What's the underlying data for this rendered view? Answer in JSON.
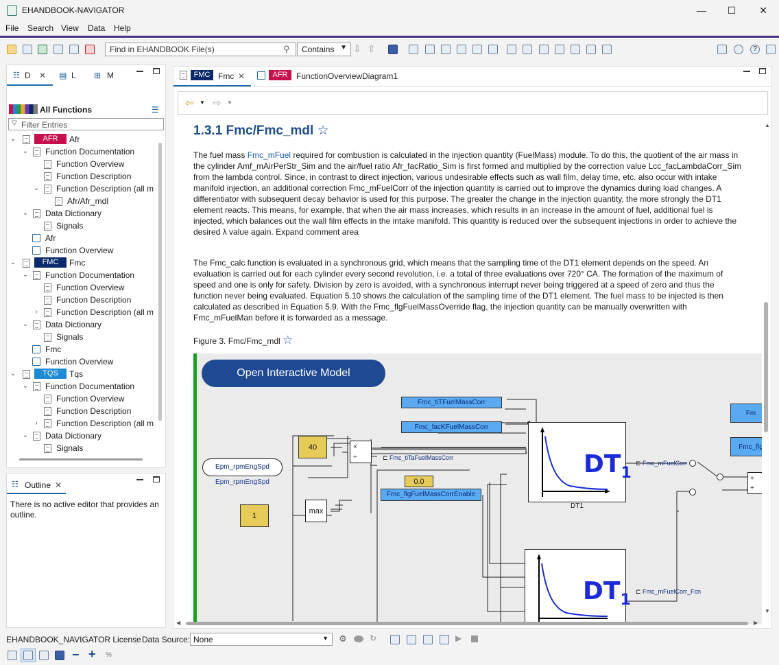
{
  "window": {
    "title": "EHANDBOOK-NAVIGATOR",
    "minimize": "—",
    "maximize": "☐",
    "close": "✕"
  },
  "menu": [
    "File",
    "Search",
    "View",
    "Data",
    "Help"
  ],
  "toolbar": {
    "find_placeholder": "Find in EHANDBOOK File(s)",
    "find_mode": "Contains"
  },
  "left_panel": {
    "tabs": [
      "D",
      "L",
      "M"
    ],
    "header": "All Functions",
    "filter_placeholder": "Filter Entries",
    "tree": [
      {
        "badge": "AFR",
        "badge_color": "#c8104e",
        "label": "Afr"
      },
      {
        "label": "Function Documentation"
      },
      {
        "label": "Function Overview"
      },
      {
        "label": "Function Description"
      },
      {
        "label": "Function Description (all m"
      },
      {
        "label": "Afr/Afr_mdl"
      },
      {
        "label": "Data Dictionary"
      },
      {
        "label": "Signals"
      },
      {
        "label": "Afr"
      },
      {
        "label": "Function Overview"
      },
      {
        "badge": "FMC",
        "badge_color": "#0a2a6a",
        "label": "Fmc"
      },
      {
        "label": "Function Documentation"
      },
      {
        "label": "Function Overview"
      },
      {
        "label": "Function Description"
      },
      {
        "label": "Function Description (all m"
      },
      {
        "label": "Data Dictionary"
      },
      {
        "label": "Signals"
      },
      {
        "label": "Fmc"
      },
      {
        "label": "Function Overview"
      },
      {
        "badge": "TQS",
        "badge_color": "#1c8ad4",
        "label": "Tqs"
      },
      {
        "label": "Function Documentation"
      },
      {
        "label": "Function Overview"
      },
      {
        "label": "Function Description"
      },
      {
        "label": "Function Description (all m"
      },
      {
        "label": "Data Dictionary"
      },
      {
        "label": "Signals"
      }
    ]
  },
  "outline": {
    "title": "Outline",
    "message": "There is no active editor that provides an outline."
  },
  "editor": {
    "tabs": [
      {
        "badge": "FMC",
        "label": "Fmc"
      },
      {
        "badge": "AFR",
        "label": "FunctionOverviewDiagram1"
      }
    ],
    "heading": "1.3.1 Fmc/Fmc_mdl",
    "star": "☆",
    "p1_before": "The fuel mass ",
    "p1_link": "Fmc_mFuel",
    "p1_after": " required for combustion is calculated in the injection quantity (FuelMass) module. To do this, the quotient of the air mass in the cylinder Amf_mAirPerStr_Sim and the air/fuel ratio Afr_facRatio_Sim is first formed and multiplied by the correction value Lcc_facLambdaCorr_Sim from the lambda control. Since, in contrast to direct injection, various undesirable effects such as wall film, delay time, etc. also occur with intake manifold injection, an additional correction Fmc_mFuelCorr of the injection quantity is carried out to improve the dynamics during load changes. A differentiator with subsequent decay behavior is used for this purpose. The greater the change in the injection quantity, the more strongly the DT1 element reacts. This means, for example, that when the air mass increases, which results in an increase in the amount of fuel, additional fuel is injected, which balances out the wall film effects in the intake manifold. This quantity is reduced over the subsequent injections in order to achieve the desired λ value again. Expand comment area",
    "p2": "The Fmc_calc function is evaluated in a synchronous grid, which means that the sampling time of the DT1 element depends on the speed. An evaluation is carried out for each cylinder every second revolution, i.e. a total of three evaluations over 720° CA. The formation of the maximum of speed and one is only for safety. Division by zero is avoided, with a synchronous interrupt never being triggered at a speed of zero and thus the function never being evaluated. Equation 5.10 shows the calculation of the sampling time of the DT1 element. The fuel mass to be injected is then calculated as described in Equation 5.9. With the Fmc_flgFuelMassOverride flag, the injection quantity can be manually overwritten with Fmc_mFuelMan before it is forwarded as a message.",
    "figure_caption": "Figure 3. Fmc/Fmc_mdl",
    "open_button": "Open Interactive Model"
  },
  "diagram": {
    "sig_tiT": "Fmc_tiTFuelMassCorr",
    "sig_facK": "Fmc_facKFuelMassCorr",
    "sig_enable": "Fmc_flgFuelMassCorrEnable",
    "const_40": "40",
    "const_1": "1",
    "const_0": "0.0",
    "rpm_in": "Epm_rpmEngSpd",
    "rpm_label": "Epm_rpmEngSpd",
    "max": "max",
    "mul": "×",
    "div": "÷",
    "wire_tiTa": "Fmc_tiTaFuelMassCorr",
    "wire_mFuelCorr": "Fmc_mFuelCorr",
    "wire_mFuelCorrFcn": "Fmc_mFuelCorr_Fcn",
    "dt1_text": "DT",
    "dt1_sub": "1",
    "dt1_label": "DT1",
    "sum_plus": "+",
    "right_fm": "Fm",
    "right_flg": "Fmc_flg"
  },
  "status": {
    "license": "EHANDBOOK_NAVIGATOR License",
    "data_source_label": "Data Source:",
    "data_source_value": "None"
  },
  "bottom": {
    "minus": "−",
    "plus": "+",
    "percent": "%"
  }
}
